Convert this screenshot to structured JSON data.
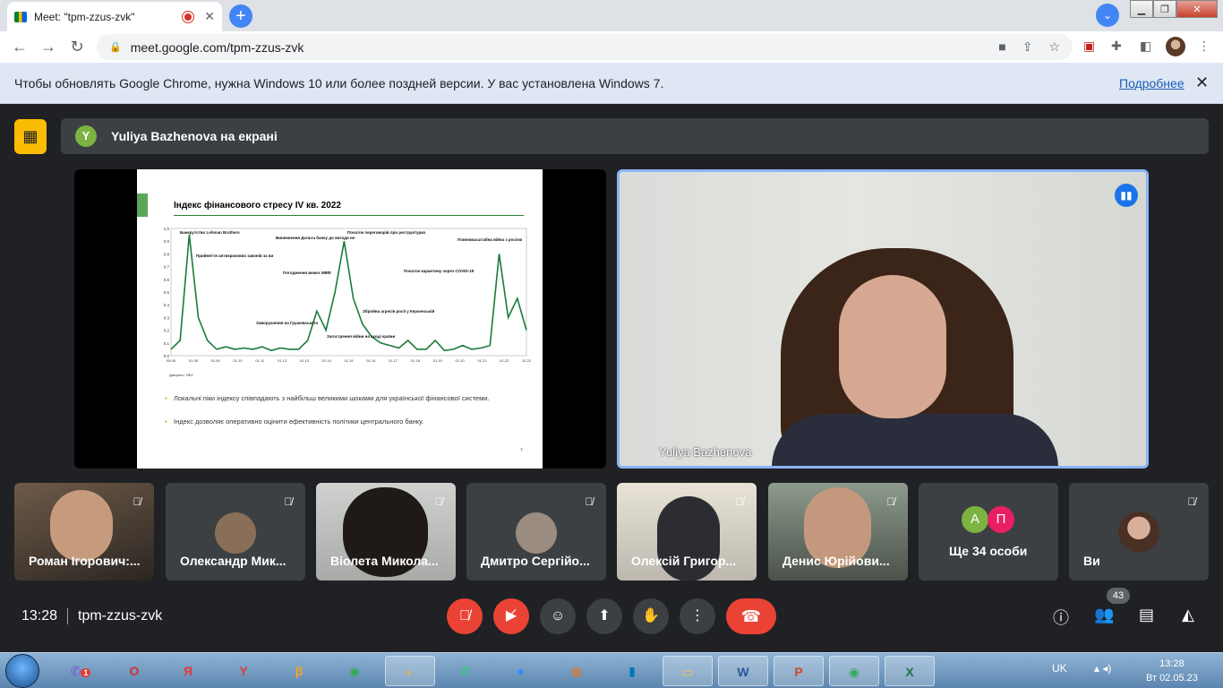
{
  "browser": {
    "tab_title": "Meet: \"tpm-zzus-zvk\"",
    "tab_close": "✕",
    "new_tab": "+",
    "url": "meet.google.com/tpm-zzus-zvk"
  },
  "infobar": {
    "message": "Чтобы обновлять Google Chrome, нужна Windows 10 или более поздней версии. У вас установлена Windows 7.",
    "link": "Подробнее"
  },
  "meet": {
    "banner_initial": "Y",
    "banner_text": "Yuliya Bazhenova на екрані",
    "slide": {
      "title": "Індекс фінансового стресу IV кв. 2022",
      "source": "Джерело: НБУ.",
      "bullets": [
        "Локальні піки індексу співпадають з найбільш великими шоками для української фінансової системи.",
        "Індекс дозволяє оперативно оцінити ефективність політики центрального банку."
      ],
      "page": "7"
    },
    "speaker_name": "Yuliya Bazhenova",
    "participants": [
      {
        "name": "Роман Ігорович:..."
      },
      {
        "name": "Олександр Мик..."
      },
      {
        "name": "Віолета Микола..."
      },
      {
        "name": "Дмитро Сергійо..."
      },
      {
        "name": "Олексій Григор..."
      },
      {
        "name": "Денис Юрійови..."
      },
      {
        "name": "Ще 34 особи",
        "initials": [
          "A",
          "П"
        ]
      },
      {
        "name": "Ви"
      }
    ],
    "time": "13:28",
    "meeting_code": "tpm-zzus-zvk",
    "participant_count": "43"
  },
  "chart_data": {
    "type": "line",
    "title": "Індекс фінансового стресу IV кв. 2022",
    "ylim": [
      0,
      1.0
    ],
    "yticks": [
      "0.0",
      "0.1",
      "0.2",
      "0.3",
      "0.4",
      "0.5",
      "0.6",
      "0.7",
      "0.8",
      "0.9",
      "1.0"
    ],
    "x": [
      "05.06",
      "01.08",
      "01.09",
      "01.10",
      "01.11",
      "01.12",
      "01.13",
      "01.14",
      "01.15",
      "01.16",
      "01.17",
      "01.18",
      "01.19",
      "01.20",
      "01.21",
      "01.22",
      "12.22"
    ],
    "series": [
      {
        "values": [
          0.05,
          0.12,
          0.95,
          0.3,
          0.12,
          0.05,
          0.07,
          0.05,
          0.06,
          0.05,
          0.07,
          0.04,
          0.06,
          0.05,
          0.05,
          0.12,
          0.35,
          0.2,
          0.5,
          0.9,
          0.45,
          0.25,
          0.15,
          0.1,
          0.08,
          0.06,
          0.12,
          0.05,
          0.05,
          0.12,
          0.04,
          0.05,
          0.08,
          0.05,
          0.06,
          0.08,
          0.8,
          0.3,
          0.45,
          0.2
        ]
      }
    ],
    "annotations": [
      "Банкрутство Lehman Brothers",
      "Прийняття антикризових законів за вимогою МВФ",
      "Виникнення Дельта банку до вигоди неплатоспроможних",
      "Початок переговорів про реструктуризацію зовнішнього боргу",
      "Повномасштабна війна з росією",
      "Погодження вимог МВФ",
      "Початок карантину через COVID-19",
      "Заворушення на Грушевського",
      "Збройна агресія росії у Керченській протоці",
      "Загострення війни на сході країни"
    ]
  },
  "taskbar": {
    "lang": "UK",
    "clock_time": "13:28",
    "clock_date": "Вт 02.05.23",
    "viber_badge": "1"
  },
  "colors": {
    "meet_bg": "#202124",
    "tile_bg": "#3c4043",
    "end_call": "#ea4335",
    "accent": "#8ab4f8",
    "chart_line": "#1b7a3a"
  }
}
